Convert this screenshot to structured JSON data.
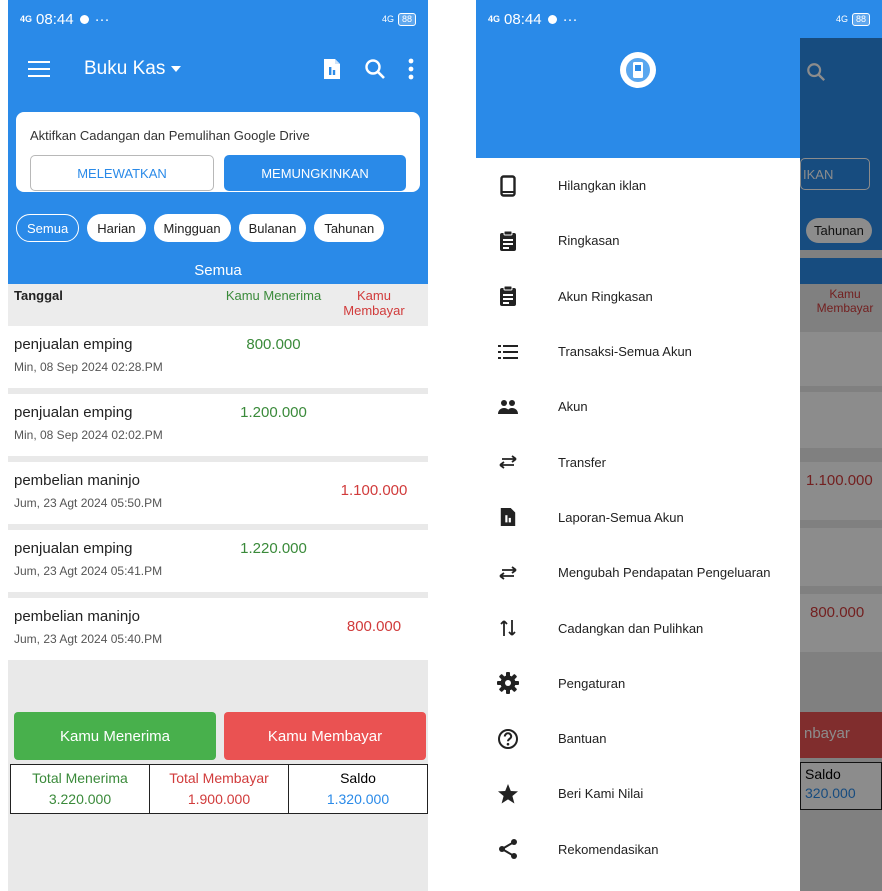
{
  "status": {
    "time": "08:44",
    "network": "4G",
    "battery": "88"
  },
  "appbar": {
    "title": "Buku Kas"
  },
  "backup_card": {
    "text": "Aktifkan Cadangan dan Pemulihan Google Drive",
    "skip_label": "MELEWATKAN",
    "enable_label": "MEMUNGKINKAN"
  },
  "filters": [
    "Semua",
    "Harian",
    "Mingguan",
    "Bulanan",
    "Tahunan"
  ],
  "section_label": "Semua",
  "columns": {
    "date": "Tanggal",
    "income": "Kamu Menerima",
    "expense": "Kamu Membayar"
  },
  "transactions": [
    {
      "name": "penjualan emping",
      "date": "Min, 08 Sep 2024 02:28.PM",
      "income": "800.000",
      "expense": ""
    },
    {
      "name": "penjualan emping",
      "date": "Min, 08 Sep 2024 02:02.PM",
      "income": "1.200.000",
      "expense": ""
    },
    {
      "name": "pembelian maninjo",
      "date": "Jum, 23 Agt 2024 05:50.PM",
      "income": "",
      "expense": "1.100.000"
    },
    {
      "name": "penjualan emping",
      "date": "Jum, 23 Agt 2024 05:41.PM",
      "income": "1.220.000",
      "expense": ""
    },
    {
      "name": "pembelian maninjo",
      "date": "Jum, 23 Agt 2024 05:40.PM",
      "income": "",
      "expense": "800.000"
    }
  ],
  "actions": {
    "receive_label": "Kamu Menerima",
    "pay_label": "Kamu Membayar"
  },
  "totals": {
    "income_label": "Total Menerima",
    "income_value": "3.220.000",
    "expense_label": "Total Membayar",
    "expense_value": "1.900.000",
    "balance_label": "Saldo",
    "balance_value": "1.320.000"
  },
  "drawer_items": [
    {
      "label": "Hilangkan iklan",
      "icon": "phone-icon"
    },
    {
      "label": "Ringkasan",
      "icon": "clipboard-icon"
    },
    {
      "label": "Akun Ringkasan",
      "icon": "clipboard-icon"
    },
    {
      "label": "Transaksi-Semua Akun",
      "icon": "list-icon"
    },
    {
      "label": "Akun",
      "icon": "people-icon"
    },
    {
      "label": "Transfer",
      "icon": "swap-icon"
    },
    {
      "label": "Laporan-Semua Akun",
      "icon": "report-icon"
    },
    {
      "label": "Mengubah Pendapatan Pengeluaran",
      "icon": "swap-icon"
    },
    {
      "label": "Cadangkan dan Pulihkan",
      "icon": "updown-icon"
    },
    {
      "label": "Pengaturan",
      "icon": "gear-icon"
    },
    {
      "label": "Bantuan",
      "icon": "help-icon"
    },
    {
      "label": "Beri Kami Nilai",
      "icon": "star-icon"
    },
    {
      "label": "Rekomendasikan",
      "icon": "share-icon"
    }
  ],
  "ghost": {
    "enable_partial": "IKAN",
    "chip_partial": "Tahunan",
    "expense_header": "Kamu Membayar",
    "expense_1": "1.100.000",
    "expense_2": "800.000",
    "pay_partial": "nbayar",
    "saldo_label": "Saldo",
    "saldo_partial": "320.000"
  },
  "colors": {
    "primary": "#2a8ae8",
    "income": "#3a8a3a",
    "expense": "#d13b3b",
    "green_button": "#48b04c",
    "red_button": "#ea5252"
  }
}
